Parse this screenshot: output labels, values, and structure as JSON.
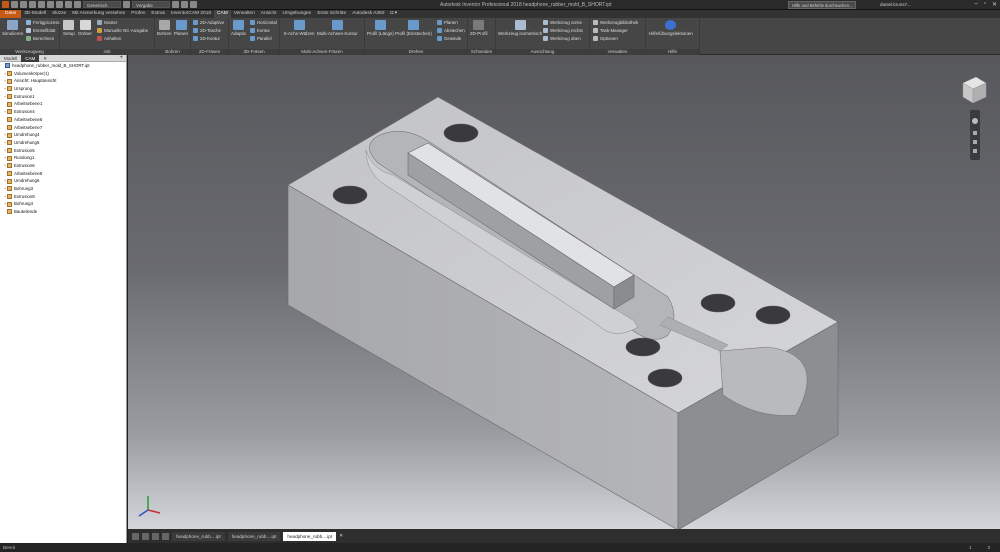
{
  "window": {
    "title": "Autodesk Inventor Professional 2018   headphone_rubber_mold_B_SHORT.ipt",
    "search_placeholder": "Hilfe und Befehle durchsuchen...",
    "user": "daniel.bruns7...",
    "qat_material": "Generisch",
    "qat_appearance": "Vorgabe"
  },
  "menu": [
    "Datei",
    "3D-Modell",
    "Skizze",
    "Mit Anmerkung versehen",
    "Prüfen",
    "Extras",
    "InventorCAM 2018",
    "CAM",
    "Verwalten",
    "Ansicht",
    "Umgebungen",
    "Erste Schritte",
    "Autodesk A360"
  ],
  "ribbon": {
    "werkzeugweg": {
      "label": "Werkzeugweg",
      "simulieren": "Simulieren",
      "fertigprozess": "Fertigprozess",
      "einstellblatt": "Einstellblatt",
      "berechnen": "Berechnen"
    },
    "job": {
      "label": "Job",
      "setup": "Setup",
      "ordner": "Ordner",
      "muster": "Muster",
      "manuelle_nc": "Manuelle NC-Ausgabe",
      "anhalten": "Anhalten"
    },
    "bohren": {
      "label": "Bohren",
      "bohren": "Bohren",
      "planen": "Planen"
    },
    "fraesen2d": {
      "label": "2D-Fräsen",
      "adaptive": "2D-Adaptive",
      "tasche": "2D-Tasche",
      "kontur": "2D-Kontur"
    },
    "fraesen3d": {
      "label": "3D-Fräsen",
      "adaptiv": "Adaptiv",
      "horizontal": "Horizontal",
      "kontur": "Kontur",
      "parallel": "Parallel"
    },
    "multiachsen": {
      "label": "Multi-Achsen-Fräsen",
      "fuenf": "5-Achs-Wälzen",
      "multikontur": "Multi-Achsen-Kontur"
    },
    "drehen": {
      "label": "Drehen",
      "profil_laengs": "Profil (Längs)",
      "profil_einstechen": "Profil (Einstechen)",
      "planen": "Planen",
      "abstechen": "Abstechen",
      "gewinde": "Gewinde"
    },
    "schneiden": {
      "label": "Schneiden",
      "profil2d": "2D-Profil"
    },
    "ausrichtung": {
      "label": "Ausrichtung",
      "isometrisch": "Werkzeug isometrisch",
      "vorne": "Werkzeug vorne",
      "rechts": "Werkzeug rechts",
      "oben": "Werkzeug oben"
    },
    "verwalten": {
      "label": "Verwalten",
      "bibliothek": "Werkzeugbibliothek",
      "taskmanager": "Task-Manager",
      "optionen": "Optionen"
    },
    "hilfe": {
      "label": "Hilfe",
      "uebung": "Hilfe/Übungslektionen"
    }
  },
  "browser": {
    "tabs": [
      "Modell",
      "CAM"
    ],
    "rows": [
      {
        "label": "headphone_rubber_mold_B_SHORT.ipt",
        "expand": "",
        "root": true
      },
      {
        "label": "Volumenkörper(1)",
        "expand": "+"
      },
      {
        "label": "Ansicht: Hauptansicht",
        "expand": "+"
      },
      {
        "label": "Ursprung",
        "expand": "+"
      },
      {
        "label": "Extrusion1",
        "expand": "+"
      },
      {
        "label": "Arbeitsebene1",
        "expand": ""
      },
      {
        "label": "Extrusion4",
        "expand": "+"
      },
      {
        "label": "Arbeitsebene6",
        "expand": ""
      },
      {
        "label": "Arbeitsebene7",
        "expand": ""
      },
      {
        "label": "Umdrehung4",
        "expand": "+"
      },
      {
        "label": "Umdrehung5",
        "expand": "+"
      },
      {
        "label": "Extrusion5",
        "expand": "+"
      },
      {
        "label": "Rundung1",
        "expand": "+"
      },
      {
        "label": "Extrusion6",
        "expand": "+"
      },
      {
        "label": "Arbeitsebene8",
        "expand": ""
      },
      {
        "label": "Umdrehung6",
        "expand": "+"
      },
      {
        "label": "Bohrung3",
        "expand": "+"
      },
      {
        "label": "Extrusion8",
        "expand": "+"
      },
      {
        "label": "Bohrung4",
        "expand": "+"
      },
      {
        "label": "Bauteilende",
        "expand": ""
      }
    ]
  },
  "doc_tabs": [
    "headphone_rubb....ipt",
    "headphone_rubb....ipt",
    "headphone_rubb....ipt"
  ],
  "status": {
    "left": "Bereit",
    "page": "1",
    "count": "3"
  }
}
